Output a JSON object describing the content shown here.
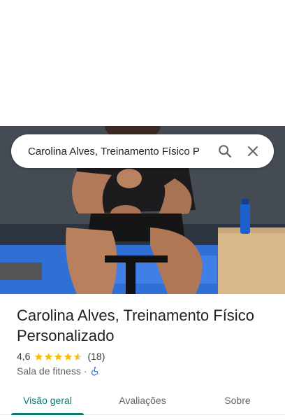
{
  "search": {
    "query": "Carolina Alves, Treinamento Físico P",
    "search_icon": "search-icon",
    "close_icon": "close-icon"
  },
  "photo": {
    "description_icon": "place-photo"
  },
  "place": {
    "name": "Carolina Alves, Treinamento Físico Personalizado",
    "rating": "4,6",
    "rating_value": 4.6,
    "reviews": "(18)",
    "category": "Sala de fitness",
    "separator": "·",
    "accessibility_icon": "wheelchair-accessible-icon"
  },
  "tabs": [
    {
      "label": "Visão geral",
      "active": true
    },
    {
      "label": "Avaliações",
      "active": false
    },
    {
      "label": "Sobre",
      "active": false
    }
  ],
  "colors": {
    "star": "#fbbc04",
    "accent": "#0b7a75",
    "accessibility": "#1a73e8"
  }
}
